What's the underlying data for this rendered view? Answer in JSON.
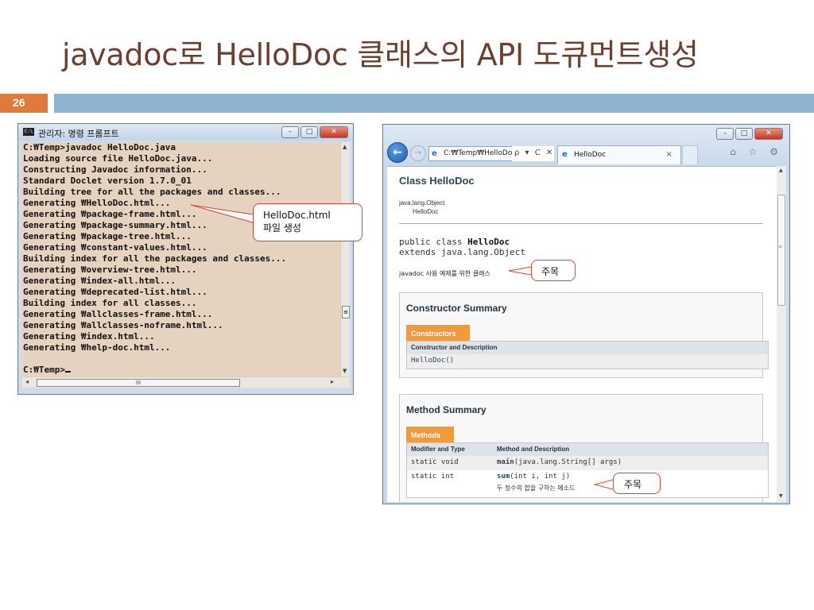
{
  "slide": {
    "title": "javadoc로 HelloDoc 클래스의 API 도큐먼트생성",
    "page_number": "26"
  },
  "cmd": {
    "icon_text": "C:\\",
    "title": "관리자: 명령 프롬프트",
    "lines": [
      "C:₩Temp>javadoc HelloDoc.java",
      "Loading source file HelloDoc.java...",
      "Constructing Javadoc information...",
      "Standard Doclet version 1.7.0_01",
      "Building tree for all the packages and classes...",
      "Generating ₩HelloDoc.html...",
      "Generating ₩package-frame.html...",
      "Generating ₩package-summary.html...",
      "Generating ₩package-tree.html...",
      "Generating ₩constant-values.html...",
      "Building index for all the packages and classes...",
      "Generating ₩overview-tree.html...",
      "Generating ₩index-all.html...",
      "Generating ₩deprecated-list.html...",
      "Building index for all classes...",
      "Generating ₩allclasses-frame.html...",
      "Generating ₩allclasses-noframe.html...",
      "Generating ₩index.html...",
      "Generating ₩help-doc.html...",
      "",
      "C:₩Temp>"
    ],
    "hscroll_grip": "III"
  },
  "callouts": {
    "html_file_line1": "HelloDoc.html",
    "html_file_line2": "파일 생성",
    "comment1": "주목",
    "comment2": "주목"
  },
  "browser": {
    "address": "C:₩Temp₩HelloDoc",
    "address_tools": "ρ ▾ C ✕",
    "tab_title": "HelloDoc",
    "tab_close": "×",
    "toolbar_icons": "⌂ ☆ ⚙",
    "doc": {
      "class_title": "Class HelloDoc",
      "inheritance_parent": "java.lang.Object",
      "inheritance_child": "HelloDoc",
      "signature_prefix": "public class ",
      "signature_name": "HelloDoc",
      "signature_extends": "extends java.lang.Object",
      "class_comment": "javadoc 사용 예제를 위한 클래스",
      "constructor_summary": {
        "heading": "Constructor Summary",
        "caption": "Constructors",
        "column_header": "Constructor and Description",
        "rows": [
          "HelloDoc()"
        ]
      },
      "method_summary": {
        "heading": "Method Summary",
        "caption": "Methods",
        "col1_header": "Modifier and Type",
        "col2_header": "Method and Description",
        "rows": [
          {
            "type": "static void",
            "name": "main",
            "params": "(java.lang.String[] args)",
            "desc": ""
          },
          {
            "type": "static int",
            "name": "sum",
            "params": "(int i, int j)",
            "desc": "두 정수의 합을 구하는 메소드"
          }
        ]
      }
    }
  },
  "colors": {
    "title": "#6b4030",
    "page_badge": "#e07a3a",
    "header_bar": "#8fb4d2",
    "cmd_bg": "#e6d3bf",
    "callout_border": "#d9433a",
    "javadoc_caption": "#f09a3a"
  }
}
